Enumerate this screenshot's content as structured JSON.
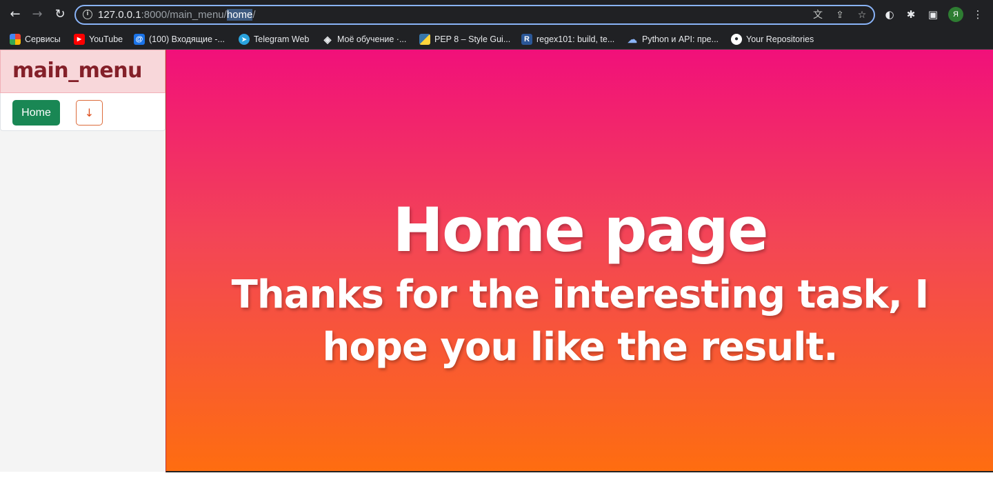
{
  "browser": {
    "url_host": "127.0.0.1",
    "url_path_plain": ":8000/main_menu/",
    "url_path_selected": "home",
    "url_path_end": "/",
    "profile_letter": "Я",
    "icons": {
      "back": "←",
      "forward": "→",
      "reload": "↻",
      "translate": "文",
      "share": "⇪",
      "star": "☆",
      "ext1": "◐",
      "extensions": "✱",
      "sidebar": "▣",
      "menu": "⋮"
    }
  },
  "bookmarks": [
    {
      "label": "Сервисы",
      "icon": "apps-grid-icon",
      "color": "#4285f4",
      "glyph": "⋮"
    },
    {
      "label": "YouTube",
      "icon": "youtube-icon",
      "color": "#ff0000",
      "glyph": "▶"
    },
    {
      "label": "(100) Входящие -...",
      "icon": "mail-icon",
      "color": "#1a73e8",
      "glyph": "@"
    },
    {
      "label": "Telegram Web",
      "icon": "telegram-icon",
      "color": "#2aa3de",
      "glyph": "➤"
    },
    {
      "label": "Моё обучение ·...",
      "icon": "learning-icon",
      "color": "#5f6368",
      "glyph": "◈"
    },
    {
      "label": "PEP 8 – Style Gui...",
      "icon": "python-icon",
      "color": "#3776ab",
      "glyph": "◆"
    },
    {
      "label": "regex101: build, te...",
      "icon": "regex101-icon",
      "color": "#2b5797",
      "glyph": "R"
    },
    {
      "label": "Python и API: пре...",
      "icon": "cloud-icon",
      "color": "#5b8ac9",
      "glyph": "☁"
    },
    {
      "label": "Your Repositories",
      "icon": "github-icon",
      "color": "#24292e",
      "glyph": "●"
    }
  ],
  "sidebar": {
    "title": "main_menu",
    "home_label": "Home",
    "dropdown_glyph": "↓"
  },
  "hero": {
    "title": "Home page",
    "subtitle": "Thanks for the interesting task, I hope you like the result."
  }
}
